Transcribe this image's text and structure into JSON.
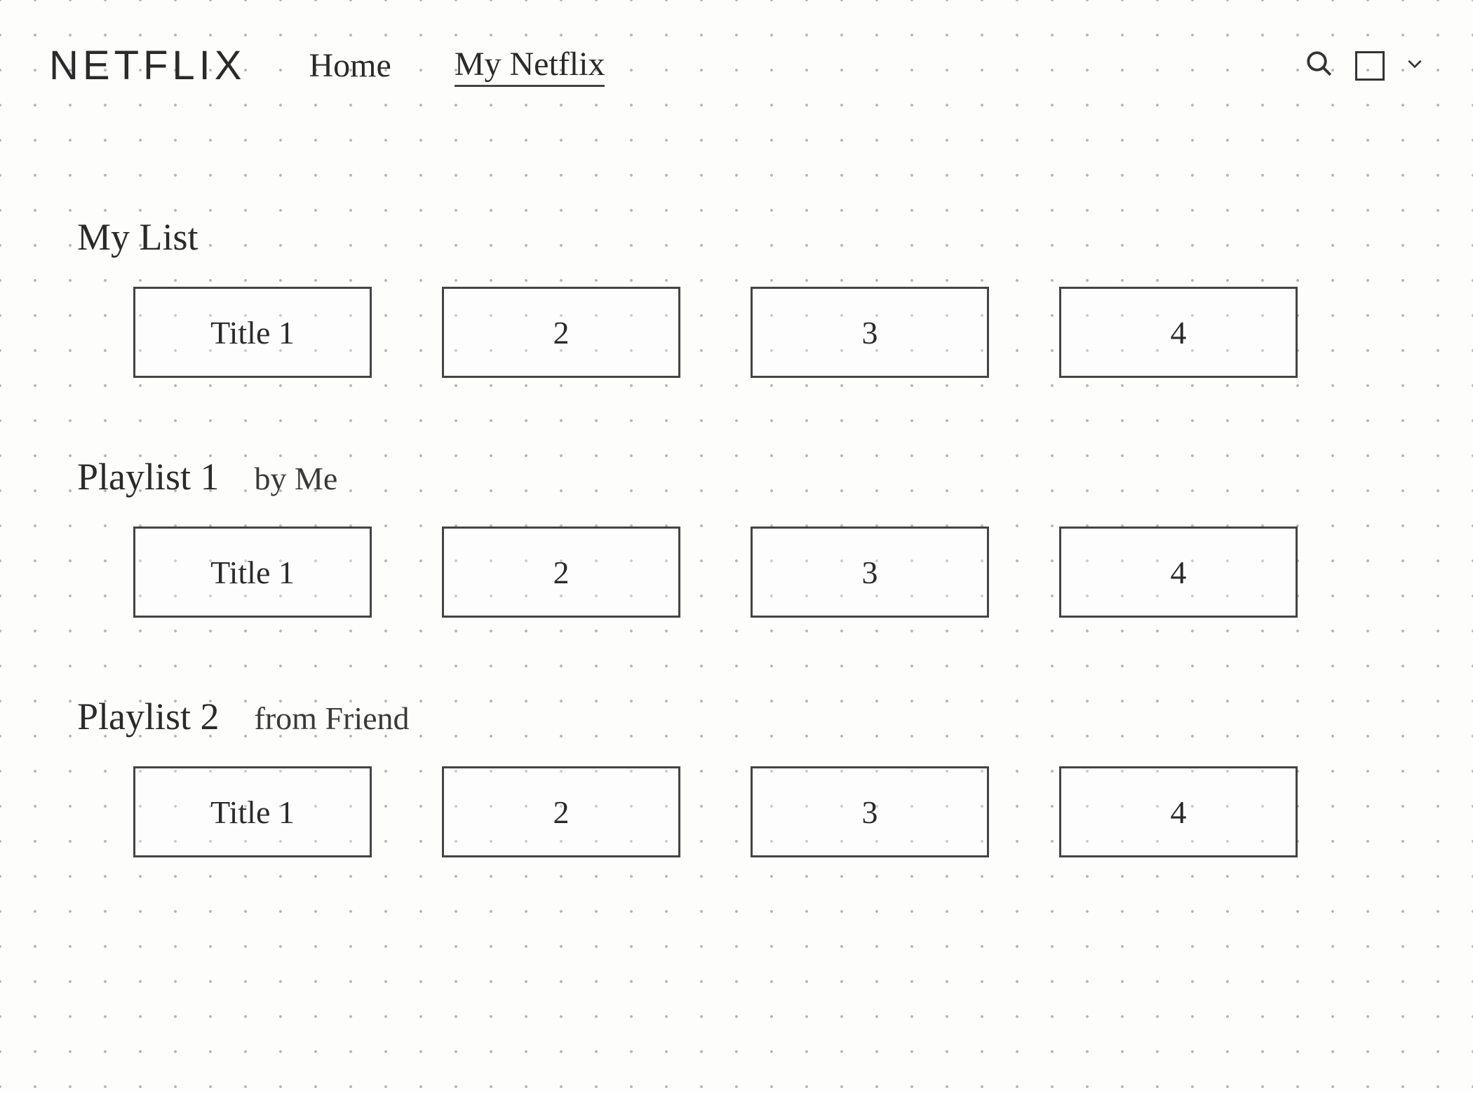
{
  "header": {
    "logo": "NETFLIX",
    "nav": {
      "home": "Home",
      "my_netflix": "My Netflix"
    },
    "active_nav": "my_netflix",
    "icons": {
      "search": "search-icon",
      "profile": "profile-box",
      "dropdown": "chevron-down-icon"
    }
  },
  "sections": [
    {
      "title": "My List",
      "subtitle": "",
      "tiles": [
        "Title 1",
        "2",
        "3",
        "4"
      ]
    },
    {
      "title": "Playlist 1",
      "subtitle": "by Me",
      "tiles": [
        "Title 1",
        "2",
        "3",
        "4"
      ]
    },
    {
      "title": "Playlist 2",
      "subtitle": "from Friend",
      "tiles": [
        "Title 1",
        "2",
        "3",
        "4"
      ]
    }
  ]
}
